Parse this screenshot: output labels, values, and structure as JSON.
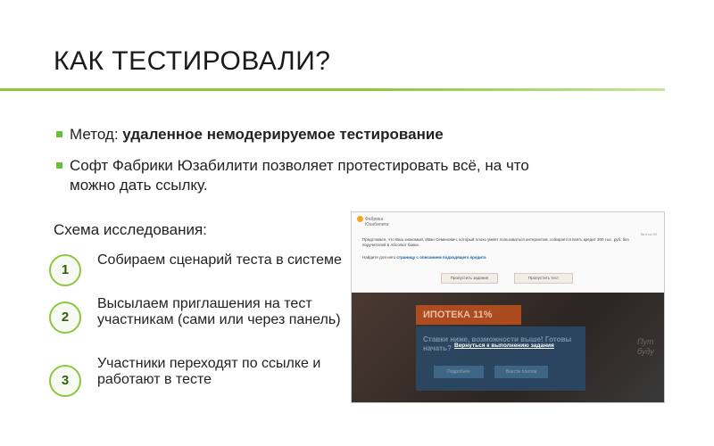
{
  "title": "КАК ТЕСТИРОВАЛИ?",
  "bullets": {
    "b1_prefix": "Метод: ",
    "b1_bold": "удаленное немодерируемое тестирование",
    "b2": "Софт Фабрики Юзабилити позволяет протестировать всё, на что можно дать ссылку."
  },
  "scheme_title": "Схема исследования:",
  "steps": [
    {
      "num": "1",
      "text": "Собираем сценарий теста в системе"
    },
    {
      "num": "2",
      "text": "Высылаем приглашения на тест участникам (сами или через панель)"
    },
    {
      "num": "3",
      "text": "Участники переходят по ссылке и работают в тесте"
    }
  ],
  "screenshot": {
    "logo_line1": "Фабрика",
    "logo_line2": "Юзабилити",
    "task_count": "№ 9 из 30",
    "task_text": "Представьте, что Ваш знакомый, Иван Семенович, который плохо умеет пользоваться интернетом, собирается взять кредит 300 тыс. руб. без поручителей в Абсолют банке.",
    "task_link_prefix": "Найдите для него ",
    "task_link": "страницу с описанием подходящего кредита",
    "btn_skip": "Пропустить задание",
    "btn_give_up": "Пропустить тест",
    "promo_title": "ИПОТЕКА 11%",
    "promo_line": "Ставки ниже, возможности выше! Готовы начать?",
    "overlay_link": "Вернуться к выполнению задания",
    "promo_btn1": "Подробнее",
    "promo_btn2": "Внести платеж",
    "side_text": "Пут буду"
  },
  "colors": {
    "accent_green": "#8dc63f",
    "bullet_green": "#6abf3a"
  }
}
